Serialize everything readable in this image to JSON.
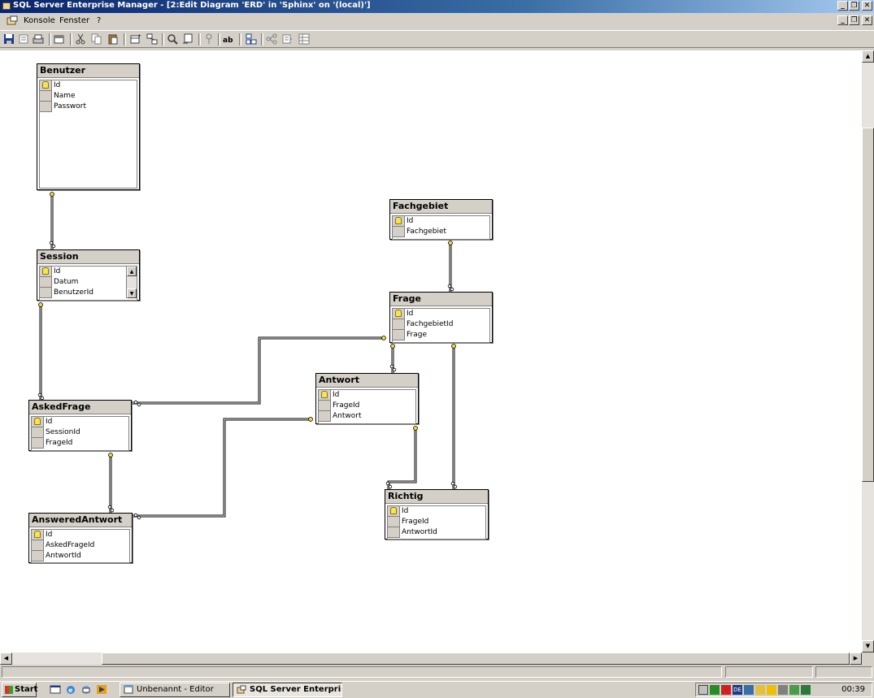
{
  "window": {
    "title": "SQL Server Enterprise Manager - [2:Edit Diagram 'ERD' in 'Sphinx' on '(local)']"
  },
  "menu": {
    "items": [
      "Konsole",
      "Fenster",
      "?"
    ]
  },
  "toolbar": {
    "icons": [
      "save-icon",
      "properties-icon",
      "print-icon",
      "new-table-icon",
      "cut-icon",
      "copy-icon",
      "paste-icon",
      "add-table-icon",
      "add-related-icon",
      "zoom-icon",
      "layout-icon",
      "key-icon",
      "text-label-icon",
      "arrange-icon",
      "relationship-icon",
      "manage-indexes-icon"
    ]
  },
  "tables": [
    {
      "name": "Benutzer",
      "columns": [
        {
          "name": "Id",
          "pk": true
        },
        {
          "name": "Name",
          "pk": false
        },
        {
          "name": "Passwort",
          "pk": false
        }
      ]
    },
    {
      "name": "Session",
      "columns": [
        {
          "name": "Id",
          "pk": true
        },
        {
          "name": "Datum",
          "pk": false
        },
        {
          "name": "BenutzerId",
          "pk": false
        }
      ]
    },
    {
      "name": "Fachgebiet",
      "columns": [
        {
          "name": "Id",
          "pk": true
        },
        {
          "name": "Fachgebiet",
          "pk": false
        }
      ]
    },
    {
      "name": "Frage",
      "columns": [
        {
          "name": "Id",
          "pk": true
        },
        {
          "name": "FachgebietId",
          "pk": false
        },
        {
          "name": "Frage",
          "pk": false
        }
      ]
    },
    {
      "name": "Antwort",
      "columns": [
        {
          "name": "Id",
          "pk": true
        },
        {
          "name": "FrageId",
          "pk": false
        },
        {
          "name": "Antwort",
          "pk": false
        }
      ]
    },
    {
      "name": "AskedFrage",
      "columns": [
        {
          "name": "Id",
          "pk": true
        },
        {
          "name": "SessionId",
          "pk": false
        },
        {
          "name": "FrageId",
          "pk": false
        }
      ]
    },
    {
      "name": "AnsweredAntwort",
      "columns": [
        {
          "name": "Id",
          "pk": true
        },
        {
          "name": "AskedFrageId",
          "pk": false
        },
        {
          "name": "AntwortId",
          "pk": false
        }
      ]
    },
    {
      "name": "Richtig",
      "columns": [
        {
          "name": "Id",
          "pk": true
        },
        {
          "name": "FrageId",
          "pk": false
        },
        {
          "name": "AntwortId",
          "pk": false
        }
      ]
    }
  ],
  "taskbar": {
    "start_label": "Start",
    "tasks": [
      {
        "label": "Unbenannt - Editor",
        "active": false
      },
      {
        "label": "SQL Server Enterprise ...",
        "active": true
      }
    ],
    "tray": {
      "lang": "DE",
      "clock": "00:39"
    }
  }
}
